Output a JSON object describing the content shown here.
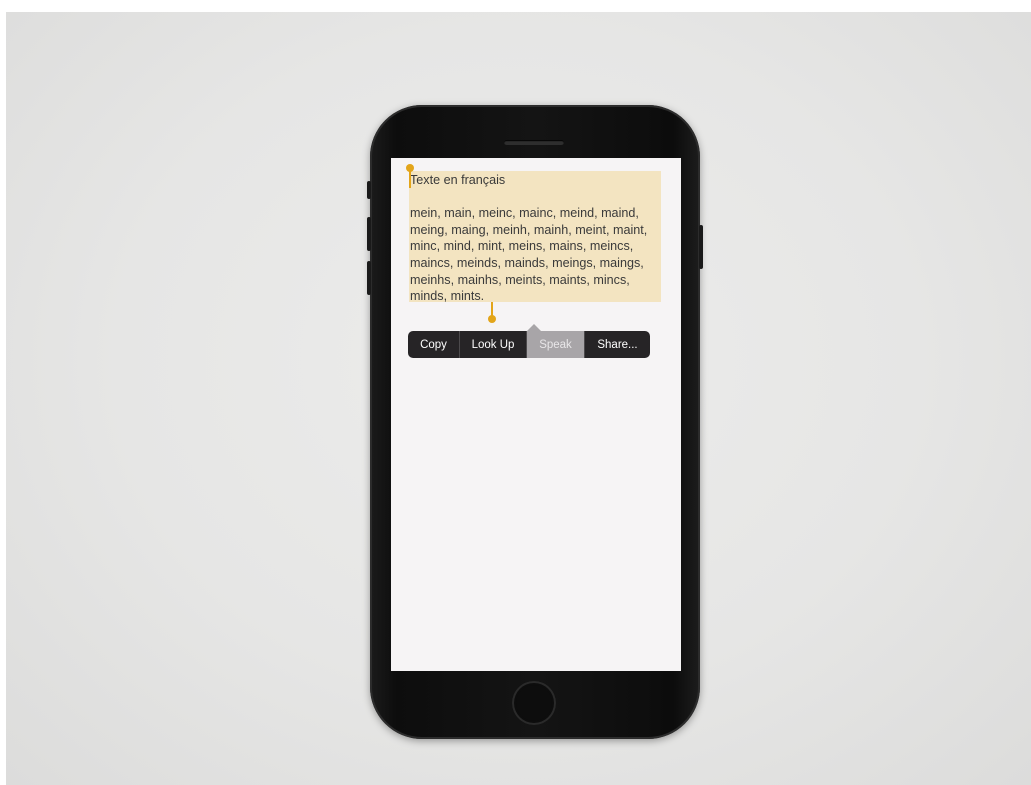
{
  "note": {
    "title": "Texte en français",
    "body_lines": [
      "mein, main, meinc, mainc, meind, maind,",
      "meing, maing, meinh, mainh, meint, maint,",
      "minc, mind, mint, meins, mains, meincs,",
      "maincs, meinds, mainds, meings, maings,",
      "meinhs, mainhs, meints, maints, mincs,",
      "minds, mints."
    ]
  },
  "edit_menu": {
    "items": [
      {
        "label": "Copy",
        "state": "normal"
      },
      {
        "label": "Look Up",
        "state": "normal"
      },
      {
        "label": "Speak",
        "state": "highlighted"
      },
      {
        "label": "Share...",
        "state": "normal"
      }
    ]
  },
  "colors": {
    "selection_highlight": "#f3e4c1",
    "selection_handles": "#e3a51a",
    "menu_background": "#262426",
    "menu_highlight": "#a8a5a8"
  }
}
